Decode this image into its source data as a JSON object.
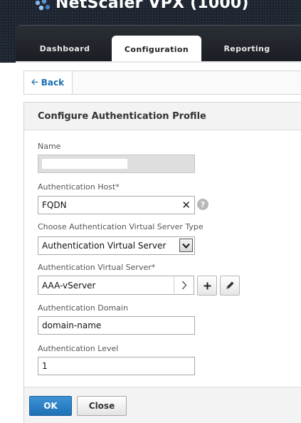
{
  "app": {
    "title": "NetScaler VPX (1000)"
  },
  "tabs": [
    {
      "label": "Dashboard"
    },
    {
      "label": "Configuration"
    },
    {
      "label": "Reporting"
    }
  ],
  "back_label": "Back",
  "panel": {
    "title": "Configure Authentication Profile",
    "fields": {
      "name_label": "Name",
      "name_value": "",
      "host_label": "Authentication Host*",
      "host_value": "FQDN",
      "vserver_type_label": "Choose Authentication Virtual Server Type",
      "vserver_type_value": "Authentication Virtual Server",
      "vserver_label": "Authentication Virtual Server*",
      "vserver_value": "AAA-vServer",
      "domain_label": "Authentication Domain",
      "domain_value": "domain-name",
      "level_label": "Authentication Level",
      "level_value": "1"
    }
  },
  "buttons": {
    "ok": "OK",
    "close": "Close"
  },
  "icons": {
    "logo": "netscaler-logo-icon",
    "back": "arrow-left-icon",
    "clear": "close-icon",
    "help": "question-mark-icon",
    "dropdown": "chevron-down-icon",
    "chevron": "chevron-right-icon",
    "add": "plus-icon",
    "edit": "pencil-icon"
  },
  "colors": {
    "primary_button": "#2a7fc4",
    "link": "#1a6fb0",
    "header": "#1c2430"
  }
}
